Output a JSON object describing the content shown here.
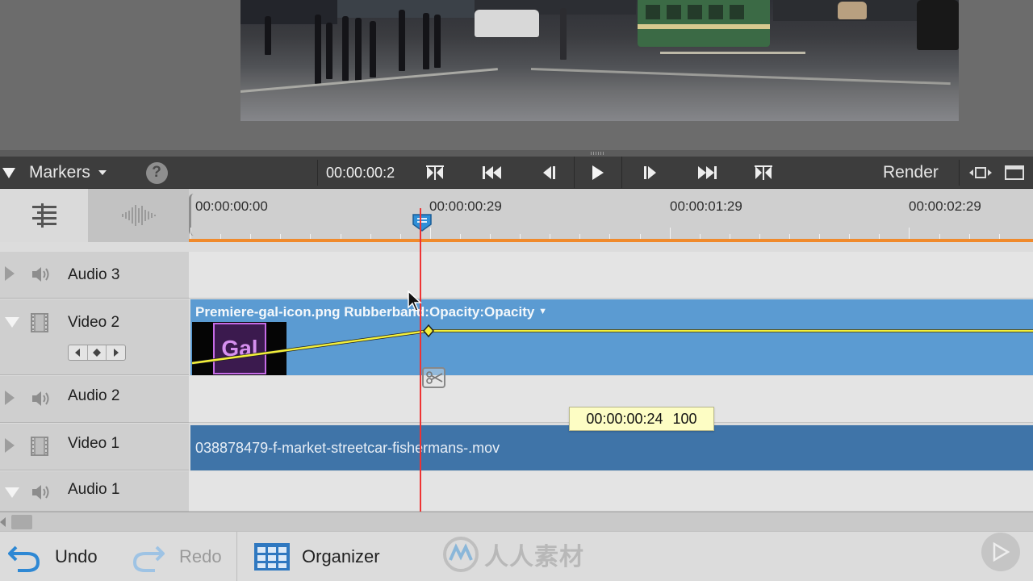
{
  "toolbar": {
    "markers_label": "Markers",
    "help_label": "?",
    "timecode": "00:00:00:2",
    "render_label": "Render",
    "transport": [
      "go-to-previous-edit-icon",
      "go-to-beginning-icon",
      "step-back-icon",
      "play-icon",
      "step-forward-icon",
      "go-to-end-icon",
      "go-to-next-edit-icon"
    ]
  },
  "ruler": {
    "labels": [
      "00:00:00:00",
      "00:00:00:29",
      "00:00:01:29",
      "00:00:02:29"
    ]
  },
  "tracks": [
    {
      "name": "Audio 3",
      "type": "audio",
      "expanded": false
    },
    {
      "name": "Video 2",
      "type": "video",
      "expanded": true
    },
    {
      "name": "Audio 2",
      "type": "audio",
      "expanded": false
    },
    {
      "name": "Video 1",
      "type": "video",
      "expanded": false
    },
    {
      "name": "Audio 1",
      "type": "audio",
      "expanded": true
    }
  ],
  "clips": {
    "gal": {
      "title": "Premiere-gal-icon.png Rubberband:Opacity:Opacity",
      "thumb_text": "Gal"
    },
    "mov": {
      "title": "038878479-f-market-streetcar-fishermans-.mov"
    }
  },
  "tooltip": {
    "time": "00:00:00:24",
    "value": "100"
  },
  "bottom": {
    "undo_label": "Undo",
    "redo_label": "Redo",
    "organizer_label": "Organizer"
  },
  "watermark": {
    "text": "人人素材"
  },
  "colors": {
    "toolbar_bg": "#3d3d3d",
    "clip_video2": "#5b9bd2",
    "clip_video1": "#3f74a8",
    "playhead": "#ee3333",
    "ruler_accent": "#f08a2c",
    "rubberband": "#f3f03a",
    "tooltip_bg": "#fdfdc4"
  }
}
